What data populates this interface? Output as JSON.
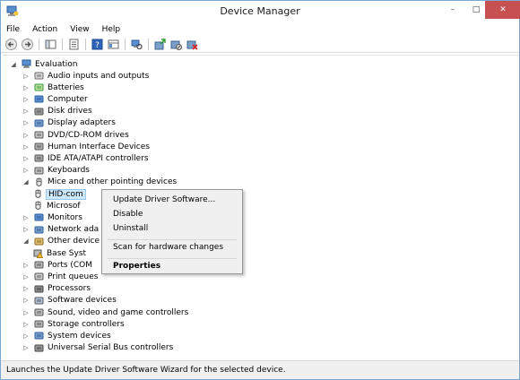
{
  "window": {
    "title": "Device Manager",
    "minimize_glyph": "–",
    "maximize_glyph": "□",
    "close_glyph": "✕"
  },
  "menu": {
    "items": [
      "File",
      "Action",
      "View",
      "Help"
    ]
  },
  "toolbar": {
    "buttons": [
      "back-arrow-icon",
      "forward-arrow-icon",
      "show-hide-console-tree-icon",
      "properties-icon",
      "help-icon",
      "view-icon",
      "scan-hardware-icon",
      "update-driver-icon",
      "disable-device-icon",
      "uninstall-device-icon"
    ]
  },
  "tree": {
    "root": "Evaluation",
    "categories": [
      {
        "label": "Audio inputs and outputs",
        "icon": "audio-icon"
      },
      {
        "label": "Batteries",
        "icon": "battery-icon"
      },
      {
        "label": "Computer",
        "icon": "computer-icon"
      },
      {
        "label": "Disk drives",
        "icon": "disk-drive-icon"
      },
      {
        "label": "Display adapters",
        "icon": "display-adapter-icon"
      },
      {
        "label": "DVD/CD-ROM drives",
        "icon": "dvd-drive-icon"
      },
      {
        "label": "Human Interface Devices",
        "icon": "hid-icon"
      },
      {
        "label": "IDE ATA/ATAPI controllers",
        "icon": "ide-controller-icon"
      },
      {
        "label": "Keyboards",
        "icon": "keyboard-icon"
      },
      {
        "label": "Mice and other pointing devices",
        "icon": "mouse-icon",
        "expanded": true
      },
      {
        "label": "HID-com",
        "icon": "mouse-icon",
        "child": true,
        "selected": true
      },
      {
        "label": "Microsof",
        "icon": "mouse-icon",
        "child": true
      },
      {
        "label": "Monitors",
        "icon": "monitor-icon"
      },
      {
        "label": "Network ada",
        "icon": "network-adapter-icon"
      },
      {
        "label": "Other device",
        "icon": "other-devices-icon",
        "expanded": true
      },
      {
        "label": "Base Syst",
        "icon": "warning-device-icon",
        "child": true
      },
      {
        "label": "Ports (COM",
        "icon": "port-icon"
      },
      {
        "label": "Print queues",
        "icon": "printer-icon"
      },
      {
        "label": "Processors",
        "icon": "processor-icon"
      },
      {
        "label": "Software devices",
        "icon": "software-device-icon"
      },
      {
        "label": "Sound, video and game controllers",
        "icon": "sound-icon"
      },
      {
        "label": "Storage controllers",
        "icon": "storage-controller-icon"
      },
      {
        "label": "System devices",
        "icon": "system-device-icon"
      },
      {
        "label": "Universal Serial Bus controllers",
        "icon": "usb-icon"
      }
    ]
  },
  "context_menu": {
    "items": [
      "Update Driver Software...",
      "Disable",
      "Uninstall",
      "Scan for hardware changes",
      "Properties"
    ]
  },
  "statusbar": {
    "text": "Launches the Update Driver Software Wizard for the selected device."
  },
  "colors": {
    "close_button": "#c75050",
    "selection": "#cce8ff",
    "selection_border": "#99c9ef",
    "menu_background": "#f0f0f0"
  }
}
